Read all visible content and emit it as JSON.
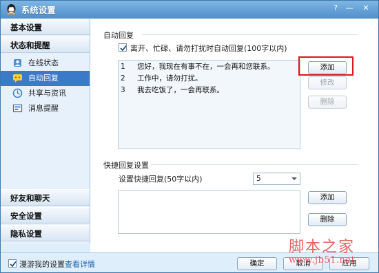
{
  "window": {
    "title": "系统设置",
    "help_label": "?",
    "min_label": "—",
    "close_label": "✕"
  },
  "sidebar": {
    "groups_top": [
      {
        "label": "基本设置"
      },
      {
        "label": "状态和提醒"
      }
    ],
    "items": [
      {
        "label": "在线状态",
        "icon": "online-status-icon"
      },
      {
        "label": "自动回复",
        "icon": "auto-reply-icon",
        "active": true
      },
      {
        "label": "共享与资讯",
        "icon": "share-icon"
      },
      {
        "label": "消息提醒",
        "icon": "message-alert-icon"
      }
    ],
    "groups_bottom": [
      {
        "label": "好友和聊天"
      },
      {
        "label": "安全设置"
      },
      {
        "label": "隐私设置"
      }
    ]
  },
  "auto_reply": {
    "section_title": "自动回复",
    "enable_label": "离开、忙碌、请勿打扰时自动回复(100字以内)",
    "enabled": true,
    "replies": [
      {
        "num": "1",
        "text": "您好，我现在有事不在，一会再和您联系。"
      },
      {
        "num": "2",
        "text": "工作中，请勿打扰。"
      },
      {
        "num": "3",
        "text": "我去吃饭了，一会再联系。"
      }
    ],
    "add_label": "添加",
    "edit_label": "修改",
    "delete_label": "删除"
  },
  "quick_reply": {
    "section_title": "快捷回复设置",
    "setting_label": "设置快捷回复(50字以内)",
    "count_value": "5",
    "add_label": "添加",
    "delete_label": "删除"
  },
  "footer": {
    "roam_label": "漫游我的设置",
    "roam_checked": true,
    "details_link": "查看详情",
    "ok_label": "确定",
    "cancel_label": "取消",
    "apply_label": "应用"
  },
  "watermark": {
    "line1": "脚本之家",
    "line2": "www.jb51.net"
  },
  "colors": {
    "accent": "#3b79c9",
    "titlebar": "#4f8fca",
    "highlight": "#d9171e",
    "link": "#1a5fb0"
  }
}
